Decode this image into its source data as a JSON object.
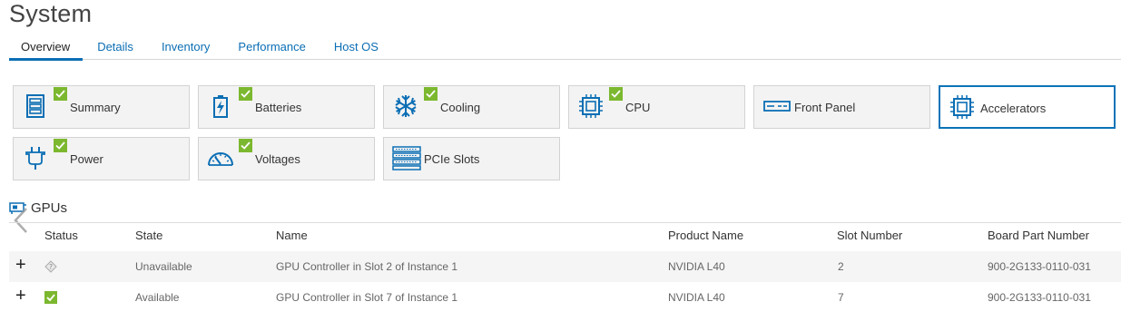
{
  "page": {
    "title": "System"
  },
  "tabs": [
    {
      "label": "Overview",
      "active": true
    },
    {
      "label": "Details"
    },
    {
      "label": "Inventory"
    },
    {
      "label": "Performance"
    },
    {
      "label": "Host OS"
    }
  ],
  "tiles": [
    {
      "label": "Summary",
      "icon": "summary-icon",
      "status": "ok"
    },
    {
      "label": "Batteries",
      "icon": "battery-icon",
      "status": "ok"
    },
    {
      "label": "Cooling",
      "icon": "snowflake-icon",
      "status": "ok"
    },
    {
      "label": "CPU",
      "icon": "cpu-chip-icon",
      "status": "ok"
    },
    {
      "label": "Front Panel",
      "icon": "front-panel-icon"
    },
    {
      "label": "Accelerators",
      "icon": "accelerator-chip-icon",
      "selected": true
    },
    {
      "label": "Power",
      "icon": "power-plug-icon",
      "status": "ok"
    },
    {
      "label": "Voltages",
      "icon": "gauge-icon",
      "status": "ok"
    },
    {
      "label": "PCIe Slots",
      "icon": "pcie-slots-icon"
    }
  ],
  "gpus": {
    "title": "GPUs",
    "columns": [
      "Status",
      "State",
      "Name",
      "Product Name",
      "Slot Number",
      "Board Part Number"
    ],
    "rows": [
      {
        "status": "unknown",
        "state": "Unavailable",
        "name": "GPU Controller in Slot 2 of Instance 1",
        "product": "NVIDIA L40",
        "slot": "2",
        "part": "900-2G133-0110-031"
      },
      {
        "status": "ok",
        "state": "Available",
        "name": "GPU Controller in Slot 7 of Instance 1",
        "product": "NVIDIA L40",
        "slot": "7",
        "part": "900-2G133-0110-031"
      }
    ]
  },
  "colors": {
    "accent": "#0b6eb4",
    "ok": "#7cb82f",
    "tile_bg": "#f3f3f3"
  }
}
